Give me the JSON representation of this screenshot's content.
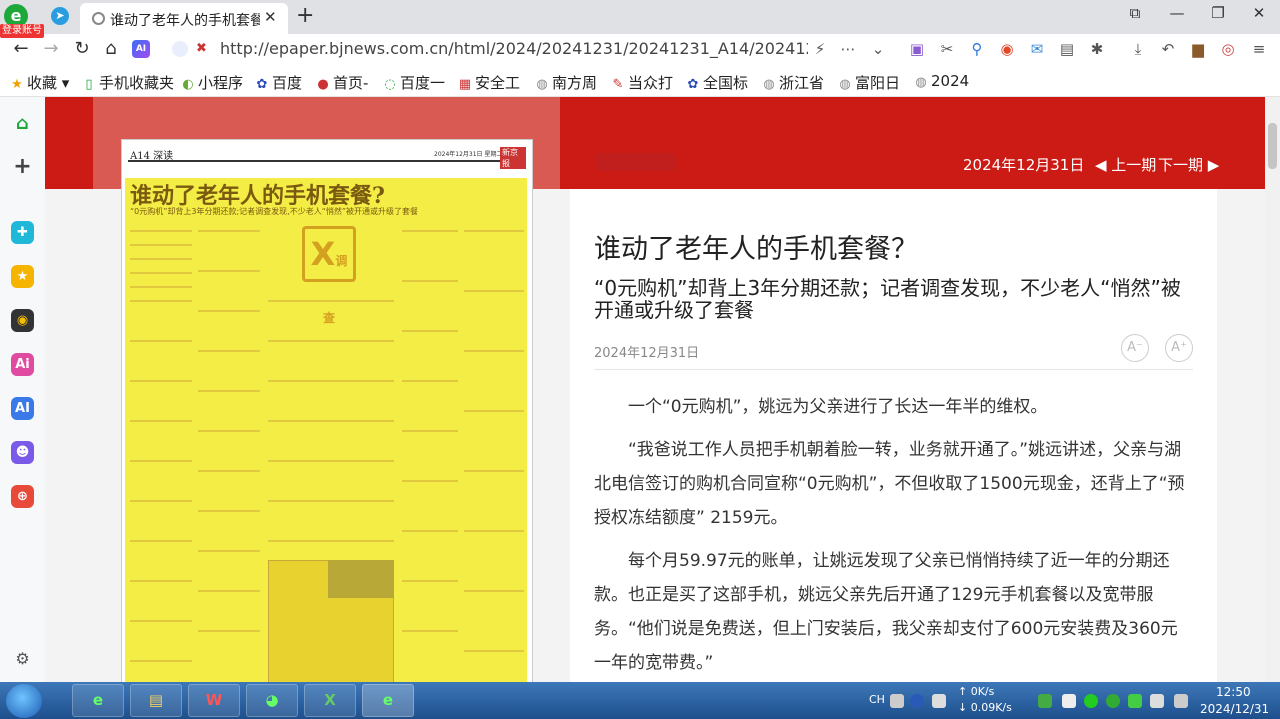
{
  "browser": {
    "login_badge": "登录账号",
    "tab_title": "谁动了老年人的手机套餐",
    "url": "http://epaper.bjnews.com.cn/html/2024/20241231/20241231_A14/20241231_A14_(",
    "ai_label": "AI",
    "bookmarks": [
      {
        "label": "收藏",
        "icon": "star-icon"
      },
      {
        "label": "手机收藏夹",
        "icon": "phone-icon"
      },
      {
        "label": "小程序",
        "icon": "miniapp-icon"
      },
      {
        "label": "百度",
        "icon": "baidu-paw-icon"
      },
      {
        "label": "首页-",
        "icon": "globe-icon"
      },
      {
        "label": "百度一",
        "icon": "globe-icon"
      },
      {
        "label": "安全工",
        "icon": "tool-icon"
      },
      {
        "label": "南方周",
        "icon": "globe-icon"
      },
      {
        "label": "当众打",
        "icon": "tool-icon"
      },
      {
        "label": "全国标",
        "icon": "baidu-paw-icon"
      },
      {
        "label": "浙江省",
        "icon": "globe-icon"
      },
      {
        "label": "富阳日",
        "icon": "globe-icon"
      },
      {
        "label": "2024",
        "icon": "globe-icon"
      }
    ]
  },
  "header": {
    "date": "2024年12月31日",
    "prev_issue": "◀ 上一期",
    "next_issue": "下一期 ▶"
  },
  "newspaper": {
    "section": "A14 深读",
    "date_line": "2024年12月31日 星期二",
    "brand": "新京报",
    "headline": "谁动了老年人的手机套餐?",
    "subheadline": "“0元购机”却背上3年分期还款;记者调查发现,不少老人“悄然”被开通或升级了套餐",
    "badge_big": "X",
    "badge_small": "调查"
  },
  "article": {
    "title": "谁动了老年人的手机套餐？",
    "subtitle": "“0元购机”却背上3年分期还款；记者调查发现，不少老人“悄然”被开通或升级了套餐",
    "date": "2024年12月31日",
    "font_smaller": "A⁻",
    "font_larger": "A⁺",
    "paragraphs": [
      "　　一个“0元购机”，姚远为父亲进行了长达一年半的维权。",
      "　　“我爸说工作人员把手机朝着脸一转，业务就开通了。”姚远讲述，父亲与湖北电信签订的购机合同宣称“0元购机”，不但收取了1500元现金，还背上了“预授权冻结额度” 2159元。",
      "　　每个月59.97元的账单，让姚远发现了父亲已悄悄持续了近一年的分期还款。也正是买了这部手机，姚远父亲先后开通了129元手机套餐以及宽带服务。“他们说是免费送，但上门安装后，我父亲却支付了600元安装费及360元一年的宽带费。”"
    ]
  },
  "taskbar": {
    "ime": "CH",
    "net_up": "↑ 0K/s",
    "net_down": "↓ 0.09K/s",
    "time": "12:50",
    "date": "2024/12/31"
  }
}
